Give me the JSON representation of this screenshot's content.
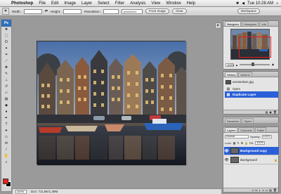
{
  "menubar": {
    "apple": "",
    "items": [
      "Photoshop",
      "File",
      "Edit",
      "Image",
      "Layer",
      "Select",
      "Filter",
      "Analysis",
      "View",
      "Window",
      "Help"
    ],
    "clock": "Tue 10:28 AM"
  },
  "options": {
    "width_label": "Width:",
    "height_label": "Height:",
    "resolution_label": "Resolution:",
    "resolution_unit": "pixels/inch",
    "front_image_label": "Front Image",
    "clear_label": "Clear",
    "workspace_label": "Workspace"
  },
  "toolbox": {
    "badge": "Ps",
    "fg_color": "#e8231c",
    "bg_color": "#000000"
  },
  "navigator": {
    "tabs": [
      "Navigator",
      "Histogram",
      "Info"
    ],
    "zoom": "100%"
  },
  "history": {
    "tabs": [
      "History",
      "Actions"
    ],
    "items": [
      {
        "label": "amsterdam.jpg",
        "icon": "thumbnail"
      },
      {
        "label": "Open",
        "icon": "open-icon"
      },
      {
        "label": "Duplicate Layer",
        "icon": "layer-icon"
      }
    ]
  },
  "layers": {
    "tabs": [
      "Layers",
      "Channels",
      "Paths"
    ],
    "blend_mode": "Normal",
    "opacity_label": "Opacity:",
    "opacity": "100%",
    "lock_label": "Lock:",
    "fill_label": "Fill:",
    "fill": "100%",
    "items": [
      {
        "label": "Background copy",
        "selected": true
      },
      {
        "label": "Background",
        "selected": false
      }
    ]
  },
  "swatches": {
    "tabs": [
      "Swatches",
      "Styles"
    ]
  },
  "status": {
    "zoom": "100%",
    "doc": "Doc: 711.9K/1.39M"
  }
}
